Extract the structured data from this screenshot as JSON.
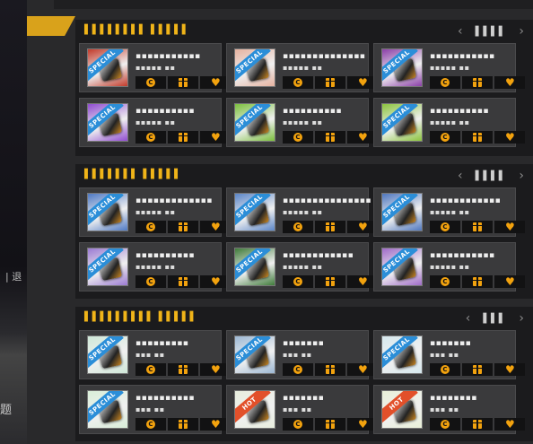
{
  "sidebar": {
    "text1": "| 退",
    "text2": "题"
  },
  "sections": [
    {
      "title": "▌▌▌▌▌▌▌▌ ▌▌▌▌▌",
      "page": "▌▌▌▌",
      "items": [
        {
          "title": "▪▪▪▪▪▪▪▪▪▪▪",
          "sub": "▪▪▪▪▪ ▪▪",
          "badge": "SPECIAL",
          "art": "#c23a2a"
        },
        {
          "title": "▪▪▪▪▪▪▪▪▪▪▪▪▪▪",
          "sub": "▪▪▪▪▪ ▪▪",
          "badge": "SPECIAL",
          "art": "#e6b2a0"
        },
        {
          "title": "▪▪▪▪▪▪▪▪▪▪▪",
          "sub": "▪▪▪▪▪ ▪▪",
          "badge": "SPECIAL",
          "art": "#8b3fa8"
        },
        {
          "title": "▪▪▪▪▪▪▪▪▪▪",
          "sub": "▪▪▪▪▪ ▪▪",
          "badge": "SPECIAL",
          "art": "#8f4bd0"
        },
        {
          "title": "▪▪▪▪▪▪▪▪▪▪",
          "sub": "▪▪▪▪▪ ▪▪",
          "badge": "SPECIAL",
          "art": "#7cbf3e"
        },
        {
          "title": "▪▪▪▪▪▪▪▪▪▪",
          "sub": "▪▪▪▪▪ ▪▪",
          "badge": "SPECIAL",
          "art": "#8cc43e"
        }
      ]
    },
    {
      "title": "▌▌▌▌▌▌▌ ▌▌▌▌▌",
      "page": "▌▌▌▌",
      "items": [
        {
          "title": "▪▪▪▪▪▪▪▪▪▪▪▪▪",
          "sub": "▪▪▪▪▪ ▪▪",
          "badge": "SPECIAL",
          "art": "#4e79c4"
        },
        {
          "title": "▪▪▪▪▪▪▪▪▪▪▪▪▪▪▪",
          "sub": "▪▪▪▪▪ ▪▪",
          "badge": "SPECIAL",
          "art": "#5b86c8"
        },
        {
          "title": "▪▪▪▪▪▪▪▪▪▪▪▪",
          "sub": "▪▪▪▪▪ ▪▪",
          "badge": "SPECIAL",
          "art": "#4f77bf"
        },
        {
          "title": "▪▪▪▪▪▪▪▪▪▪",
          "sub": "▪▪▪▪▪ ▪▪",
          "badge": "SPECIAL",
          "art": "#9b7ad2"
        },
        {
          "title": "▪▪▪▪▪▪▪▪▪▪▪▪",
          "sub": "▪▪▪▪▪ ▪▪",
          "badge": "SPECIAL",
          "art": "#3f7b3a"
        },
        {
          "title": "▪▪▪▪▪▪▪▪▪▪▪",
          "sub": "▪▪▪▪▪ ▪▪",
          "badge": "SPECIAL",
          "art": "#a06bc8"
        }
      ]
    },
    {
      "title": "▌▌▌▌▌▌▌▌▌ ▌▌▌▌▌",
      "page": "▌▌▌",
      "items": [
        {
          "title": "▪▪▪▪▪▪▪▪▪",
          "sub": "▪▪▪ ▪▪",
          "badge": "SPECIAL",
          "art": "#cfe8d8"
        },
        {
          "title": "▪▪▪▪▪▪▪",
          "sub": "▪▪▪ ▪▪",
          "badge": "SPECIAL",
          "art": "#9db8d4"
        },
        {
          "title": "▪▪▪▪▪▪▪",
          "sub": "▪▪▪ ▪▪",
          "badge": "SPECIAL",
          "art": "#d6e8ee"
        },
        {
          "title": "▪▪▪▪▪▪▪▪▪▪",
          "sub": "▪▪▪ ▪▪",
          "badge": "SPECIAL",
          "art": "#d8eed8"
        },
        {
          "title": "▪▪▪▪▪▪▪",
          "sub": "▪▪▪ ▪▪",
          "badge": "HOT",
          "art": "#e8eede"
        },
        {
          "title": "▪▪▪▪▪▪▪▪",
          "sub": "▪▪▪ ▪▪",
          "badge": "HOT",
          "art": "#e9f0d8"
        }
      ]
    }
  ],
  "buttons": {
    "coin": "C",
    "gift": "",
    "heart": "♥"
  },
  "nav": {
    "prev": "‹",
    "next": "›"
  },
  "colors": {
    "accent": "#f2a20e",
    "special": "#2b8ed8",
    "hot": "#e2502a"
  }
}
